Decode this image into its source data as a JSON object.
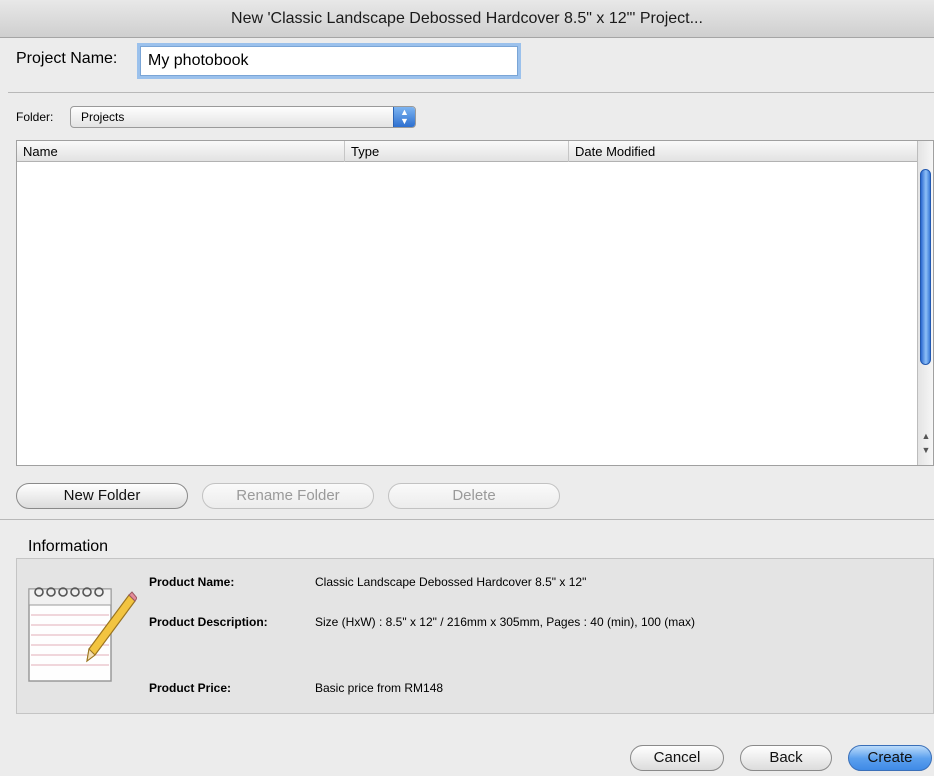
{
  "window": {
    "title": "New 'Classic Landscape Debossed Hardcover 8.5\" x 12\"' Project..."
  },
  "project_name": {
    "label": "Project Name:",
    "value": "My photobook"
  },
  "folder": {
    "label": "Folder:",
    "selected": "Projects",
    "arrow_icon": "updown-chevron-icon"
  },
  "file_list": {
    "columns": [
      "Name",
      "Type",
      "Date Modified"
    ],
    "rows": []
  },
  "folder_buttons": {
    "new_folder": "New Folder",
    "rename_folder": "Rename Folder",
    "delete": "Delete"
  },
  "information": {
    "title": "Information",
    "icon": "notepad-pencil-icon",
    "product_name_label": "Product Name:",
    "product_name_value": "Classic Landscape Debossed Hardcover 8.5\" x 12\"",
    "product_description_label": "Product Description:",
    "product_description_value": "Size (HxW) : 8.5\" x 12\" / 216mm x 305mm, Pages : 40 (min), 100 (max)",
    "product_price_label": "Product Price:",
    "product_price_value": "Basic price from RM148"
  },
  "dialog_buttons": {
    "cancel": "Cancel",
    "back": "Back",
    "create": "Create"
  },
  "colors": {
    "accent": "#3f8ae6",
    "focus_ring": "#9bc1ec"
  }
}
